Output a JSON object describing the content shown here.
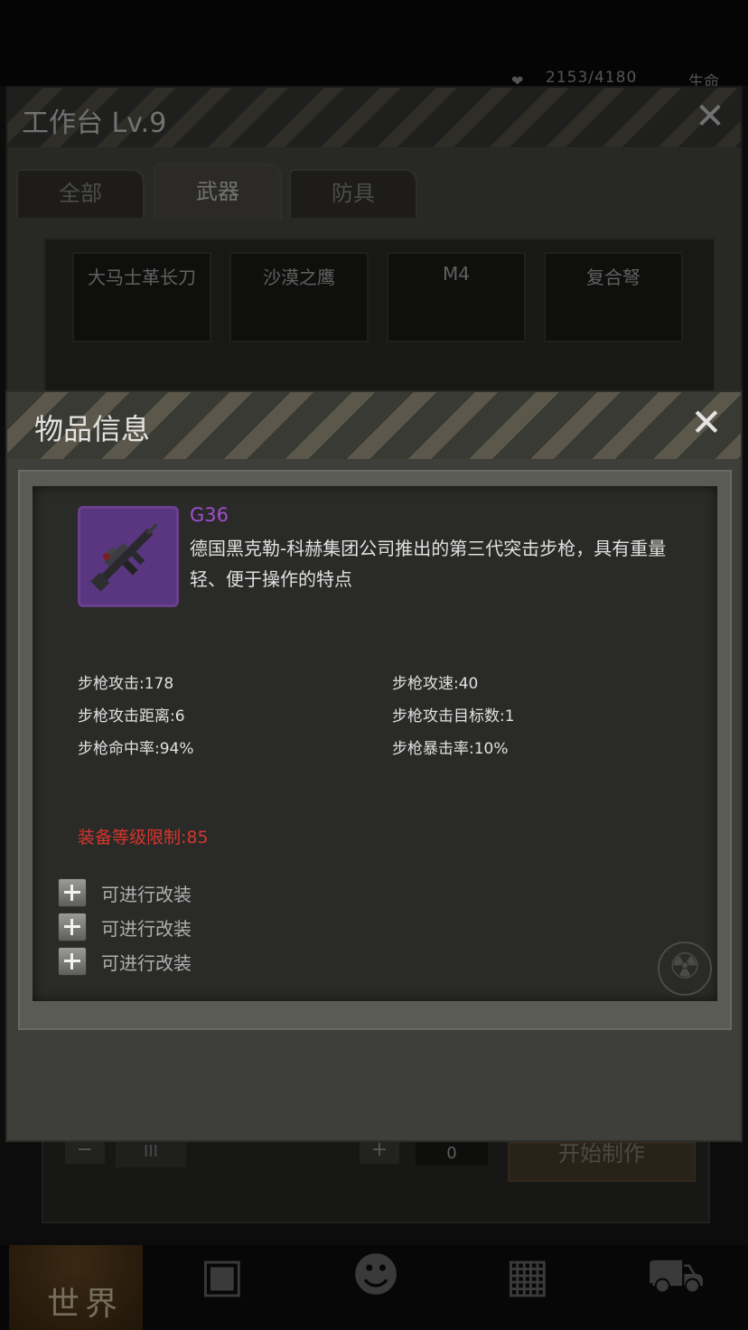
{
  "status": {
    "hp_icon": "heart-icon",
    "hp_value": "2153/4180",
    "life_label": "生命"
  },
  "workbench": {
    "title": "工作台 Lv.9",
    "close_icon": "close-icon",
    "tabs": [
      {
        "label": "全部",
        "active": false
      },
      {
        "label": "武器",
        "active": true
      },
      {
        "label": "防具",
        "active": false
      }
    ],
    "items": [
      "大马士革长刀",
      "沙漠之鹰",
      "M4",
      "复合弩"
    ],
    "quantity": "0",
    "minus_label": "−",
    "bars_label": "III",
    "plus_label": "+",
    "craft_label": "开始制作"
  },
  "nav": {
    "world_label": "世界",
    "icons": [
      "backpack-icon",
      "head-skill-icon",
      "building-icon",
      "cart-icon"
    ]
  },
  "dialog": {
    "title": "物品信息",
    "close_icon": "close-icon",
    "item": {
      "name": "G36",
      "icon": "rifle-icon",
      "rarity_color": "#a04ed2",
      "description": "德国黑克勒-科赫集团公司推出的第三代突击步枪，具有重量轻、便于操作的特点"
    },
    "stats": {
      "attack": "步枪攻击:178",
      "attack_speed": "步枪攻速:40",
      "range": "步枪攻击距离:6",
      "targets": "步枪攻击目标数:1",
      "accuracy": "步枪命中率:94%",
      "crit": "步枪暴击率:10%"
    },
    "requirement": "装备等级限制:85",
    "requirement_color": "#d5362c",
    "mods": [
      "可进行改装",
      "可进行改装",
      "可进行改装"
    ]
  }
}
